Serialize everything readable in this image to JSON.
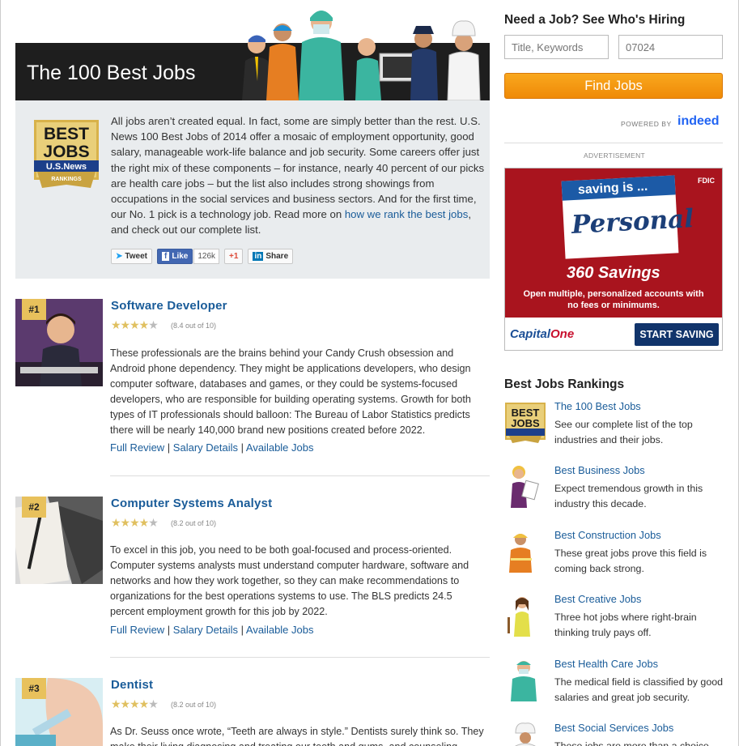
{
  "hero": {
    "title": "The 100 Best Jobs"
  },
  "badge": {
    "line1": "BEST",
    "line2": "JOBS",
    "brand": "U.S.News",
    "ribbon": "RANKINGS"
  },
  "intro": {
    "text": "All jobs aren’t created equal. In fact, some are simply better than the rest. U.S. News 100 Best Jobs of 2014 offer a mosaic of employment opportunity, good salary, manageable work-life balance and job security. Some careers offer just the right mix of these components – for instance, nearly 40 percent of our picks are health care jobs – but the list also includes strong showings from occupations in the social services and business sectors. And for the first time, our No. 1 pick is a technology job. Read more on ",
    "link_text": "how we rank the best jobs",
    "text_after": ", and check out our complete list."
  },
  "share": {
    "tweet": "Tweet",
    "like": "Like",
    "like_count": "126k",
    "gplus": "+1",
    "linkedin": "Share"
  },
  "jobs": [
    {
      "rank": "#1",
      "title": "Software Developer",
      "score": "(8.4 out of 10)",
      "desc": "These professionals are the brains behind your Candy Crush obsession and Android phone dependency. They might be applications developers, who design computer software, databases and games, or they could be systems-focused developers, who are responsible for building operating systems. Growth for both types of IT professionals should balloon: The  Bureau of Labor Statistics predicts there will be nearly 140,000 brand new positions created before 2022.",
      "links": [
        "Full Review",
        "Salary Details",
        "Available Jobs"
      ]
    },
    {
      "rank": "#2",
      "title": "Computer Systems Analyst",
      "score": "(8.2 out of 10)",
      "desc": "To excel in this job, you need to be both goal-focused and process-oriented. Computer systems analysts must understand computer hardware, software and networks and how they work together, so they can make recommendations to organizations for the best operations systems to use. The BLS predicts 24.5 percent employment growth for this job by 2022.",
      "links": [
        "Full Review",
        "Salary Details",
        "Available Jobs"
      ]
    },
    {
      "rank": "#3",
      "title": "Dentist",
      "score": "(8.2 out of 10)",
      "desc": "As Dr. Seuss once wrote, “Teeth are always in style.” Dentists surely think so. They make their living diagnosing and treating our teeth and gums, and counseling",
      "links": []
    }
  ],
  "rating": {
    "stars_on": "★★★★",
    "stars_off": "★"
  },
  "search": {
    "heading": "Need a Job? See Who's Hiring",
    "keywords_placeholder": "Title, Keywords",
    "location_placeholder": "07024",
    "button": "Find Jobs",
    "powered_by": "POWERED BY",
    "provider": "indeed"
  },
  "ad": {
    "label": "ADVERTISEMENT",
    "fdic": "FDIC",
    "card_top": "saving is ...",
    "card_word": "Personal",
    "product": "360 Savings",
    "line1": "Open multiple, personalized accounts with",
    "line2": "no fees or minimums.",
    "logo_a": "Capital",
    "logo_b": "One",
    "cta": "START SAVING"
  },
  "rankings": {
    "heading": "Best Jobs Rankings",
    "items": [
      {
        "title": "The 100 Best Jobs",
        "desc": "See our complete list of the top industries and their jobs."
      },
      {
        "title": "Best Business Jobs",
        "desc": "Expect tremendous growth in this industry this decade."
      },
      {
        "title": "Best Construction Jobs",
        "desc": "These great jobs prove this field is coming back strong."
      },
      {
        "title": "Best Creative Jobs",
        "desc": "Three hot jobs where right-brain thinking truly pays off."
      },
      {
        "title": "Best Health Care Jobs",
        "desc": "The medical field is classified by good salaries and great job security."
      },
      {
        "title": "Best Social Services Jobs",
        "desc": "These jobs are more than a choice"
      }
    ]
  },
  "colors": {
    "accent": "#1a5c99",
    "button": "#f39a12",
    "star": "#e0c060",
    "ad_red": "#a9141e"
  }
}
